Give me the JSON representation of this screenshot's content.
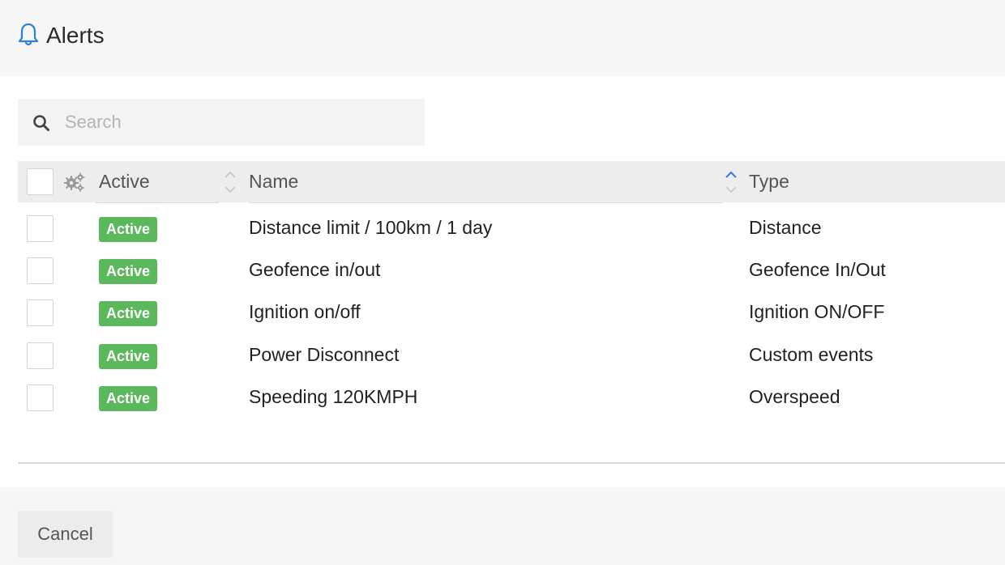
{
  "header": {
    "title": "Alerts",
    "icon": "bell-icon",
    "icon_color": "#2f7fd6"
  },
  "search": {
    "placeholder": "Search",
    "value": "",
    "icon": "search-icon"
  },
  "table": {
    "columns": {
      "active": "Active",
      "name": "Name",
      "type": "Type"
    },
    "sort": {
      "column": "Name",
      "direction": "ascending",
      "active_color": "#2f7fd6"
    },
    "rows": [
      {
        "status": "Active",
        "name": "Distance limit / 100km / 1 day",
        "type": "Distance"
      },
      {
        "status": "Active",
        "name": "Geofence in/out",
        "type": "Geofence In/Out"
      },
      {
        "status": "Active",
        "name": "Ignition on/off",
        "type": "Ignition ON/OFF"
      },
      {
        "status": "Active",
        "name": "Power Disconnect",
        "type": "Custom events"
      },
      {
        "status": "Active",
        "name": "Speeding 120KMPH",
        "type": "Overspeed"
      }
    ],
    "badge_color": "#5cb85c"
  },
  "footer": {
    "cancel_label": "Cancel"
  }
}
